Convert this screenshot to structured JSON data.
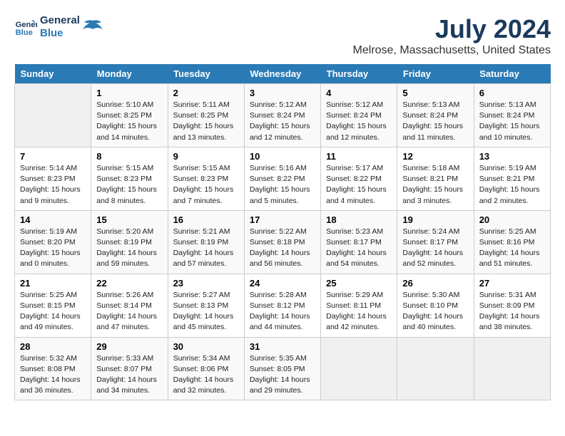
{
  "logo": {
    "line1": "General",
    "line2": "Blue"
  },
  "title": "July 2024",
  "subtitle": "Melrose, Massachusetts, United States",
  "days_header": [
    "Sunday",
    "Monday",
    "Tuesday",
    "Wednesday",
    "Thursday",
    "Friday",
    "Saturday"
  ],
  "weeks": [
    [
      {
        "num": "",
        "info": ""
      },
      {
        "num": "1",
        "info": "Sunrise: 5:10 AM\nSunset: 8:25 PM\nDaylight: 15 hours\nand 14 minutes."
      },
      {
        "num": "2",
        "info": "Sunrise: 5:11 AM\nSunset: 8:25 PM\nDaylight: 15 hours\nand 13 minutes."
      },
      {
        "num": "3",
        "info": "Sunrise: 5:12 AM\nSunset: 8:24 PM\nDaylight: 15 hours\nand 12 minutes."
      },
      {
        "num": "4",
        "info": "Sunrise: 5:12 AM\nSunset: 8:24 PM\nDaylight: 15 hours\nand 12 minutes."
      },
      {
        "num": "5",
        "info": "Sunrise: 5:13 AM\nSunset: 8:24 PM\nDaylight: 15 hours\nand 11 minutes."
      },
      {
        "num": "6",
        "info": "Sunrise: 5:13 AM\nSunset: 8:24 PM\nDaylight: 15 hours\nand 10 minutes."
      }
    ],
    [
      {
        "num": "7",
        "info": "Sunrise: 5:14 AM\nSunset: 8:23 PM\nDaylight: 15 hours\nand 9 minutes."
      },
      {
        "num": "8",
        "info": "Sunrise: 5:15 AM\nSunset: 8:23 PM\nDaylight: 15 hours\nand 8 minutes."
      },
      {
        "num": "9",
        "info": "Sunrise: 5:15 AM\nSunset: 8:23 PM\nDaylight: 15 hours\nand 7 minutes."
      },
      {
        "num": "10",
        "info": "Sunrise: 5:16 AM\nSunset: 8:22 PM\nDaylight: 15 hours\nand 5 minutes."
      },
      {
        "num": "11",
        "info": "Sunrise: 5:17 AM\nSunset: 8:22 PM\nDaylight: 15 hours\nand 4 minutes."
      },
      {
        "num": "12",
        "info": "Sunrise: 5:18 AM\nSunset: 8:21 PM\nDaylight: 15 hours\nand 3 minutes."
      },
      {
        "num": "13",
        "info": "Sunrise: 5:19 AM\nSunset: 8:21 PM\nDaylight: 15 hours\nand 2 minutes."
      }
    ],
    [
      {
        "num": "14",
        "info": "Sunrise: 5:19 AM\nSunset: 8:20 PM\nDaylight: 15 hours\nand 0 minutes."
      },
      {
        "num": "15",
        "info": "Sunrise: 5:20 AM\nSunset: 8:19 PM\nDaylight: 14 hours\nand 59 minutes."
      },
      {
        "num": "16",
        "info": "Sunrise: 5:21 AM\nSunset: 8:19 PM\nDaylight: 14 hours\nand 57 minutes."
      },
      {
        "num": "17",
        "info": "Sunrise: 5:22 AM\nSunset: 8:18 PM\nDaylight: 14 hours\nand 56 minutes."
      },
      {
        "num": "18",
        "info": "Sunrise: 5:23 AM\nSunset: 8:17 PM\nDaylight: 14 hours\nand 54 minutes."
      },
      {
        "num": "19",
        "info": "Sunrise: 5:24 AM\nSunset: 8:17 PM\nDaylight: 14 hours\nand 52 minutes."
      },
      {
        "num": "20",
        "info": "Sunrise: 5:25 AM\nSunset: 8:16 PM\nDaylight: 14 hours\nand 51 minutes."
      }
    ],
    [
      {
        "num": "21",
        "info": "Sunrise: 5:25 AM\nSunset: 8:15 PM\nDaylight: 14 hours\nand 49 minutes."
      },
      {
        "num": "22",
        "info": "Sunrise: 5:26 AM\nSunset: 8:14 PM\nDaylight: 14 hours\nand 47 minutes."
      },
      {
        "num": "23",
        "info": "Sunrise: 5:27 AM\nSunset: 8:13 PM\nDaylight: 14 hours\nand 45 minutes."
      },
      {
        "num": "24",
        "info": "Sunrise: 5:28 AM\nSunset: 8:12 PM\nDaylight: 14 hours\nand 44 minutes."
      },
      {
        "num": "25",
        "info": "Sunrise: 5:29 AM\nSunset: 8:11 PM\nDaylight: 14 hours\nand 42 minutes."
      },
      {
        "num": "26",
        "info": "Sunrise: 5:30 AM\nSunset: 8:10 PM\nDaylight: 14 hours\nand 40 minutes."
      },
      {
        "num": "27",
        "info": "Sunrise: 5:31 AM\nSunset: 8:09 PM\nDaylight: 14 hours\nand 38 minutes."
      }
    ],
    [
      {
        "num": "28",
        "info": "Sunrise: 5:32 AM\nSunset: 8:08 PM\nDaylight: 14 hours\nand 36 minutes."
      },
      {
        "num": "29",
        "info": "Sunrise: 5:33 AM\nSunset: 8:07 PM\nDaylight: 14 hours\nand 34 minutes."
      },
      {
        "num": "30",
        "info": "Sunrise: 5:34 AM\nSunset: 8:06 PM\nDaylight: 14 hours\nand 32 minutes."
      },
      {
        "num": "31",
        "info": "Sunrise: 5:35 AM\nSunset: 8:05 PM\nDaylight: 14 hours\nand 29 minutes."
      },
      {
        "num": "",
        "info": ""
      },
      {
        "num": "",
        "info": ""
      },
      {
        "num": "",
        "info": ""
      }
    ]
  ]
}
